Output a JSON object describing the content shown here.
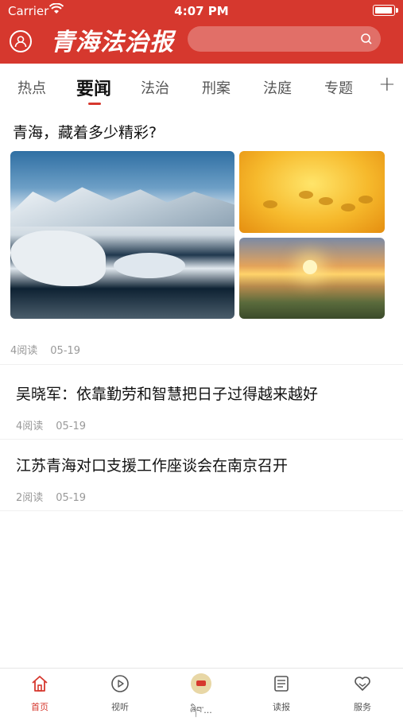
{
  "status_bar": {
    "carrier": "Carrier",
    "time": "4:07 PM"
  },
  "header": {
    "logo_text": "青海法治报",
    "search_placeholder": ""
  },
  "tabs": [
    {
      "label": "热点"
    },
    {
      "label": "要闻",
      "active": true
    },
    {
      "label": "法治"
    },
    {
      "label": "刑案"
    },
    {
      "label": "法庭"
    },
    {
      "label": "专题"
    }
  ],
  "tab_add_label": "+",
  "featured": {
    "title": "青海，藏着多少精彩?",
    "reads": "4阅读",
    "date": "05-19"
  },
  "articles": [
    {
      "title": "吴晓军：依靠勤劳和智慧把日子过得越来越好",
      "reads": "4阅读",
      "date": "05-19"
    },
    {
      "title": "江苏青海对口支援工作座谈会在南京召开",
      "reads": "2阅读",
      "date": "05-19"
    }
  ],
  "bottom_nav": [
    {
      "label": "首页",
      "icon": "home-icon",
      "active": true
    },
    {
      "label": "视听",
      "icon": "play-icon"
    },
    {
      "label": "ཞིབ་...",
      "icon": "logo-icon"
    },
    {
      "label": "读报",
      "icon": "newspaper-icon"
    },
    {
      "label": "服务",
      "icon": "heart-service-icon"
    }
  ],
  "colors": {
    "brand": "#d6382e",
    "text": "#111111",
    "muted": "#999999"
  }
}
